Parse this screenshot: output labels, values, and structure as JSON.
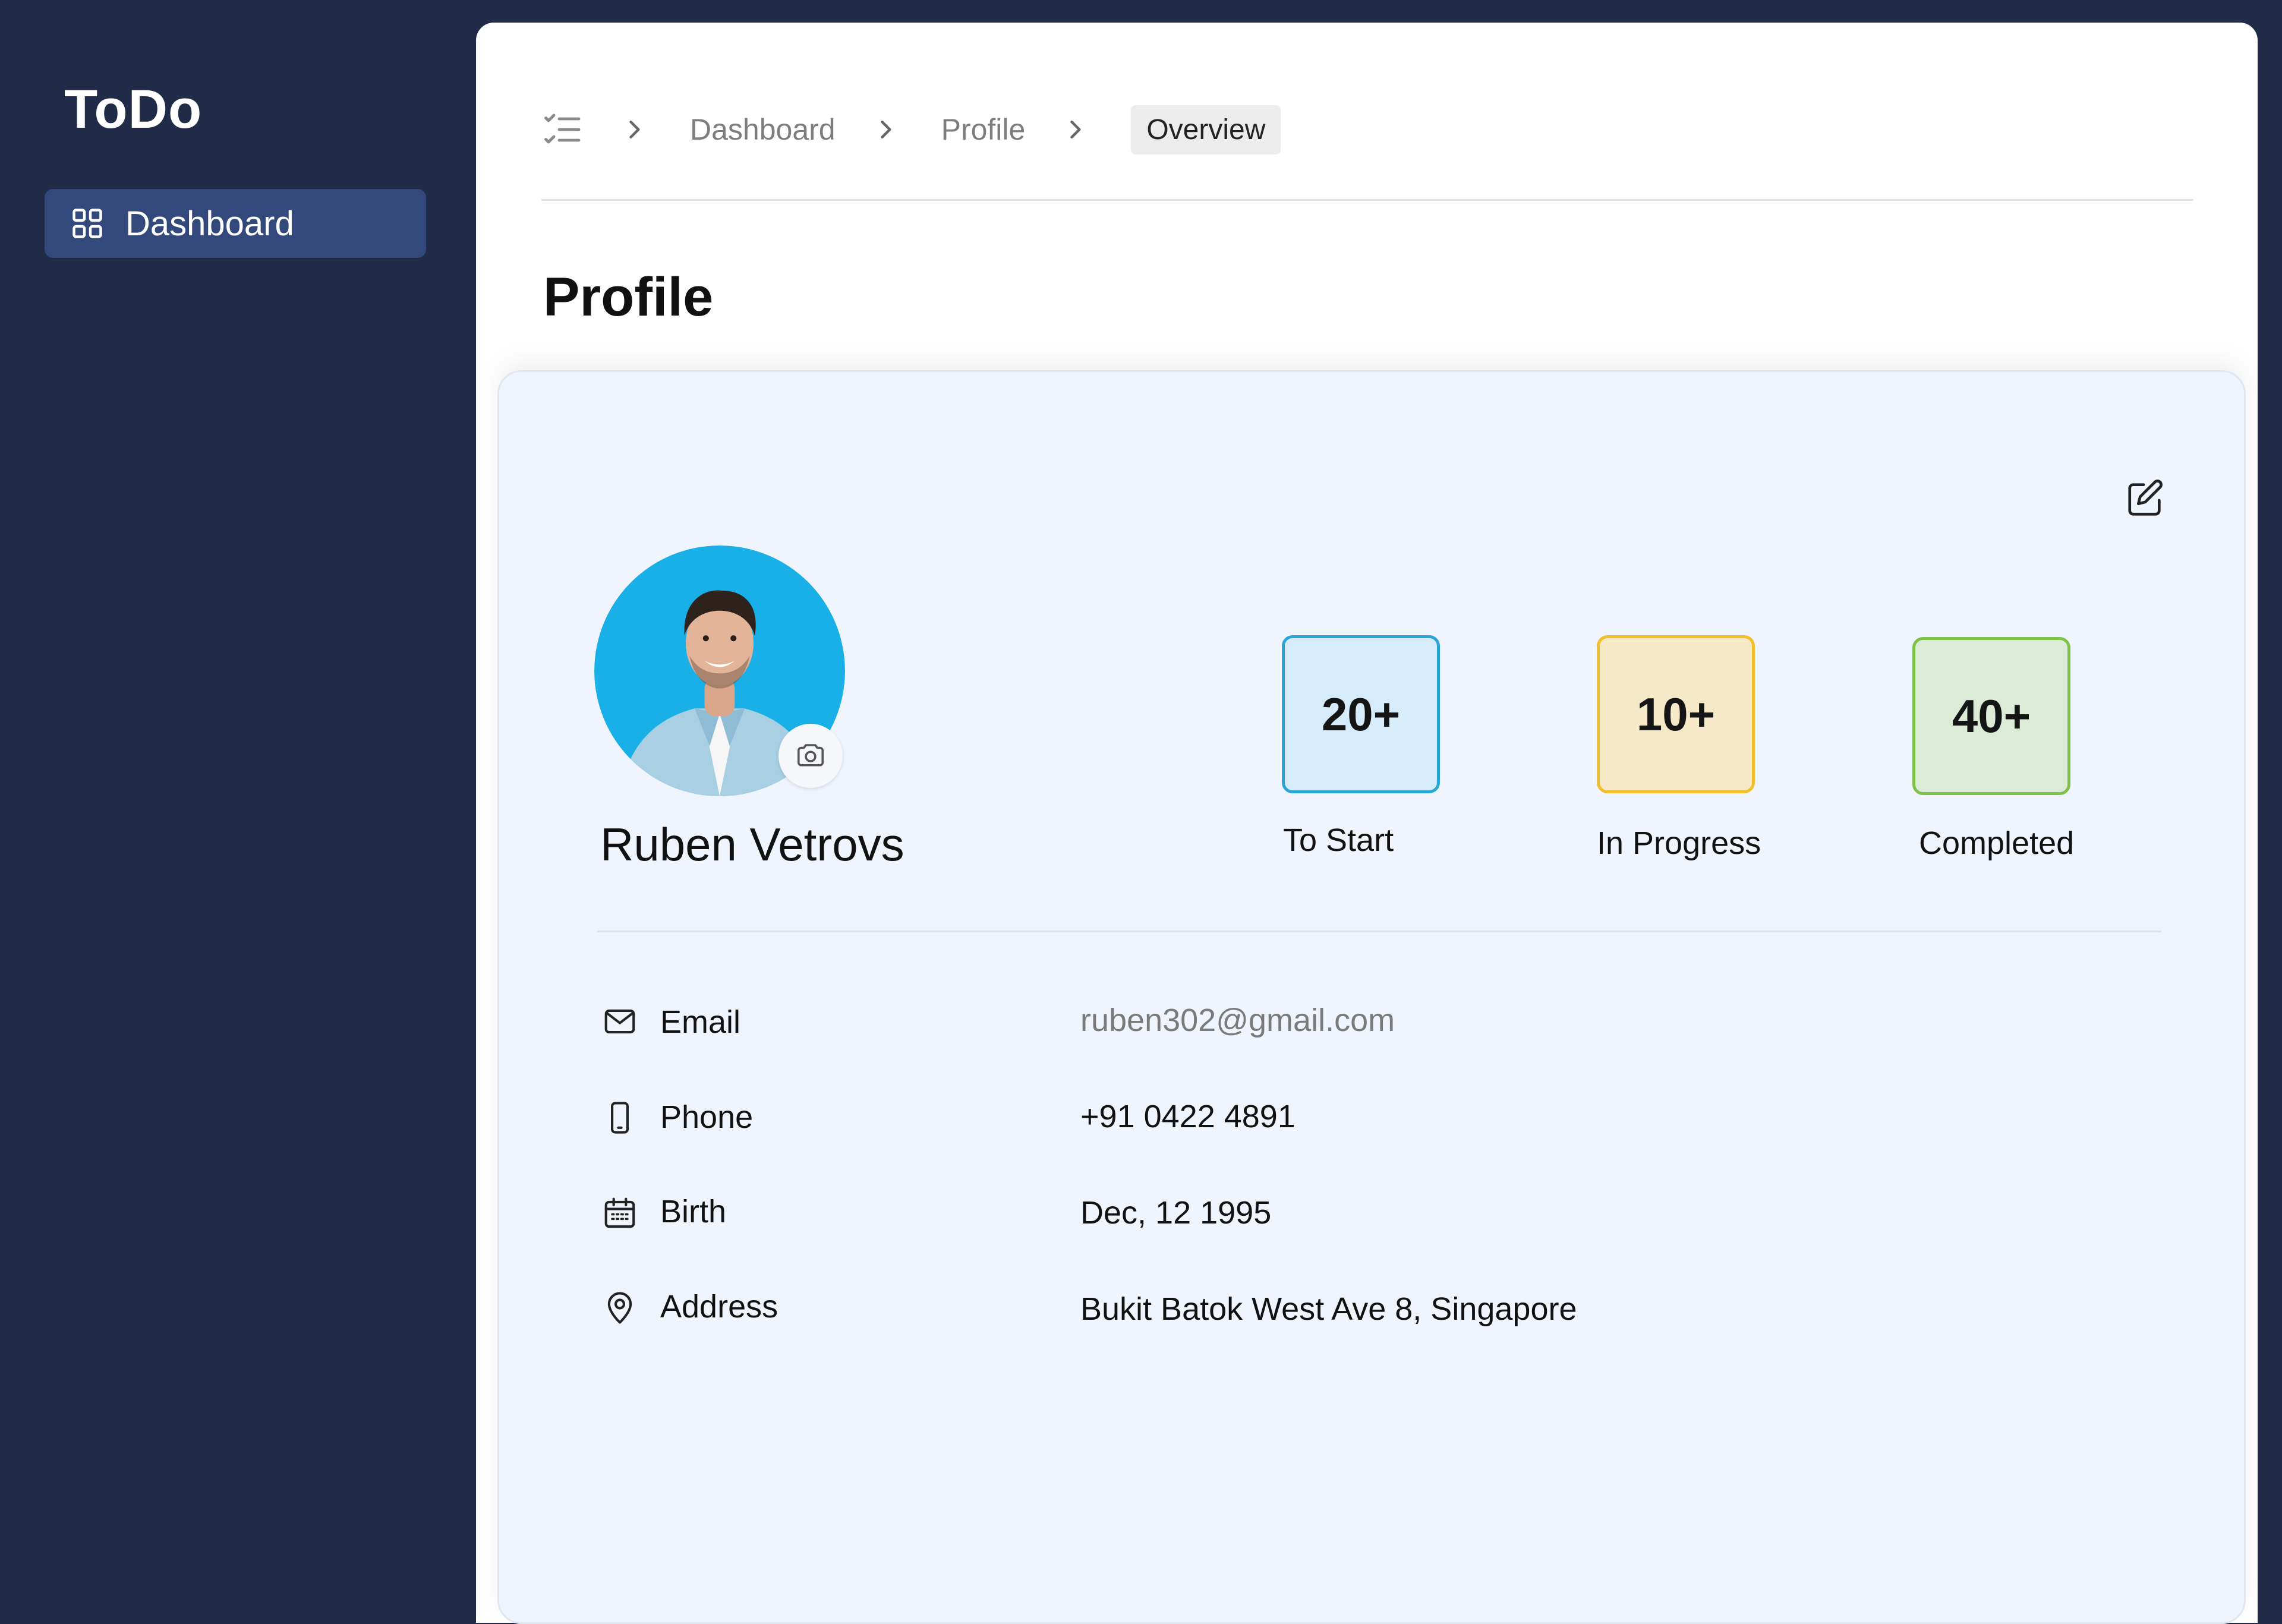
{
  "app": {
    "title": "ToDo"
  },
  "sidebar": {
    "items": [
      {
        "label": "Dashboard",
        "icon": "grid-icon",
        "active": true
      }
    ]
  },
  "breadcrumb": {
    "home_icon": "checklist-icon",
    "items": [
      "Dashboard",
      "Profile"
    ],
    "current": "Overview"
  },
  "page": {
    "title": "Profile"
  },
  "profile": {
    "name": "Ruben Vetrovs",
    "stats": [
      {
        "value": "20+",
        "label": "To Start",
        "color": "#2aa6d6",
        "bg": "#d6ecfa"
      },
      {
        "value": "10+",
        "label": "In Progress",
        "color": "#f2bf2a",
        "bg": "#f6e9c8"
      },
      {
        "value": "40+",
        "label": "Completed",
        "color": "#7fc24a",
        "bg": "#dcebd6"
      }
    ],
    "details": [
      {
        "icon": "mail-icon",
        "label": "Email",
        "value": "ruben302@gmail.com"
      },
      {
        "icon": "phone-icon",
        "label": "Phone",
        "value": "+91 0422 4891"
      },
      {
        "icon": "calendar-icon",
        "label": "Birth",
        "value": "Dec, 12 1995"
      },
      {
        "icon": "location-pin-icon",
        "label": "Address",
        "value": "Bukit Batok West Ave 8, Singapore"
      }
    ]
  },
  "colors": {
    "sidebar_bg": "#1f2b47",
    "sidebar_active": "#34497b",
    "card_bg": "#f0f5fd",
    "avatar_bg": "#1ab0e6"
  }
}
